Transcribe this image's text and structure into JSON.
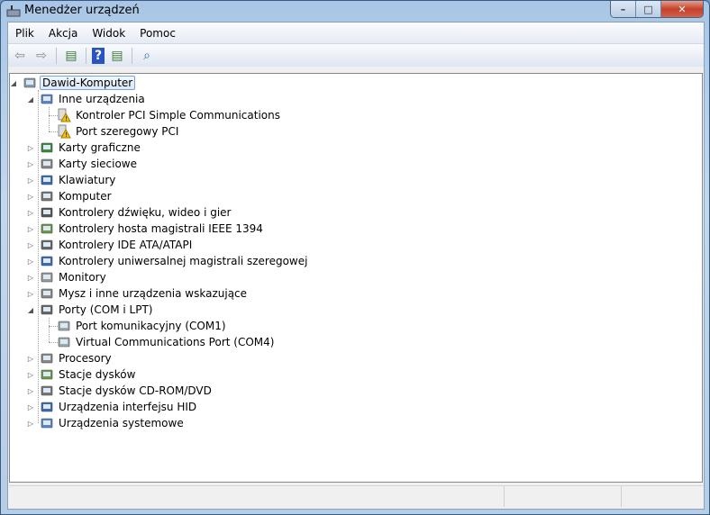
{
  "window": {
    "title": "Menedżer urządzeń",
    "minimize": "–",
    "maximize": "□",
    "close": "✕"
  },
  "menu": [
    "Plik",
    "Akcja",
    "Widok",
    "Pomoc"
  ],
  "toolbar": [
    {
      "name": "back-icon",
      "glyph": "⇦"
    },
    {
      "name": "forward-icon",
      "glyph": "⇨"
    },
    {
      "name": "console-tree-icon",
      "glyph": "▤"
    },
    {
      "name": "help-icon",
      "glyph": "?"
    },
    {
      "name": "action-pane-icon",
      "glyph": "▤"
    },
    {
      "name": "scan-hardware-icon",
      "glyph": "⌕"
    }
  ],
  "tree": {
    "root": "Dawid-Komputer",
    "items": [
      {
        "label": "Inne urządzenia",
        "expanded": true,
        "children": [
          "Kontroler PCI Simple Communications",
          "Port szeregowy PCI"
        ],
        "child_icon": "warning"
      },
      {
        "label": "Karty graficzne"
      },
      {
        "label": "Karty sieciowe"
      },
      {
        "label": "Klawiatury"
      },
      {
        "label": "Komputer"
      },
      {
        "label": "Kontrolery dźwięku, wideo i gier"
      },
      {
        "label": "Kontrolery hosta magistrali IEEE 1394"
      },
      {
        "label": "Kontrolery IDE ATA/ATAPI"
      },
      {
        "label": "Kontrolery uniwersalnej magistrali szeregowej"
      },
      {
        "label": "Monitory"
      },
      {
        "label": "Mysz i inne urządzenia wskazujące"
      },
      {
        "label": "Porty (COM i LPT)",
        "expanded": true,
        "children": [
          "Port komunikacyjny (COM1)",
          "Virtual Communications Port (COM4)"
        ],
        "child_icon": "port"
      },
      {
        "label": "Procesory"
      },
      {
        "label": "Stacje dysków"
      },
      {
        "label": "Stacje dysków CD-ROM/DVD"
      },
      {
        "label": "Urządzenia interfejsu HID"
      },
      {
        "label": "Urządzenia systemowe"
      }
    ]
  }
}
